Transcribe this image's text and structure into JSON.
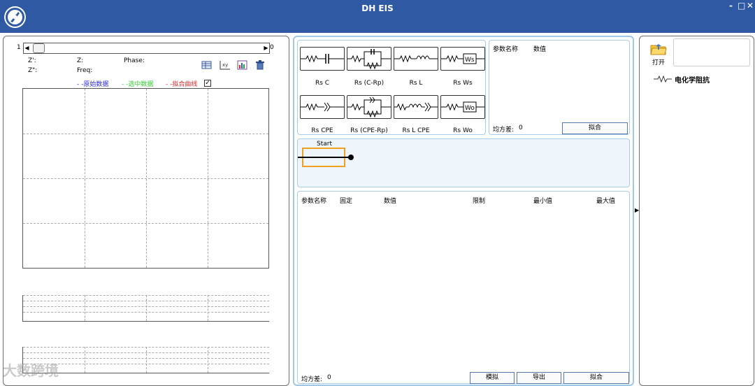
{
  "window": {
    "title": "DH EIS",
    "minimize": "-",
    "maximize": "□",
    "close": "✕"
  },
  "left_panel": {
    "slider": {
      "min_label": "1",
      "max_label": "0"
    },
    "readouts": {
      "z_real": "Z':",
      "z_mag": "Z:",
      "phase": "Phase:",
      "z_imag": "Z\":",
      "freq": "Freq:"
    },
    "legend": {
      "raw": "- -原始数据",
      "selected": "- -选中数据",
      "fit": "- -拟合曲线",
      "raw_color": "#2a2ae0",
      "selected_color": "#2fd22f",
      "fit_color": "#e02a2a"
    },
    "toolbar_icons": [
      "table-icon",
      "xy-plot-icon",
      "chart-export-icon",
      "trash-icon"
    ]
  },
  "circuits": [
    {
      "label": "Rs C",
      "icon": "rs-c-circuit-icon"
    },
    {
      "label": "Rs (C-Rp)",
      "icon": "rs-c-rp-circuit-icon"
    },
    {
      "label": "Rs L",
      "icon": "rs-l-circuit-icon"
    },
    {
      "label": "Rs Ws",
      "icon": "rs-ws-circuit-icon"
    },
    {
      "label": "Rs CPE",
      "icon": "rs-cpe-circuit-icon"
    },
    {
      "label": "Rs (CPE-Rp)",
      "icon": "rs-cpe-rp-circuit-icon"
    },
    {
      "label": "Rs L CPE",
      "icon": "rs-l-cpe-circuit-icon"
    },
    {
      "label": "Rs Wo",
      "icon": "rs-wo-circuit-icon"
    }
  ],
  "param_summary": {
    "col_name": "参数名称",
    "col_value": "数值",
    "mse_label": "均方差:",
    "mse_value": "0",
    "fit_button": "拟合"
  },
  "canvas": {
    "start_label": "Start"
  },
  "param_table": {
    "headers": [
      "参数名称",
      "固定",
      "数值",
      "限制",
      "最小值",
      "最大值"
    ],
    "mse_label": "均方差:",
    "mse_value": "0",
    "simulate_button": "模拟",
    "export_button": "导出",
    "fit_button": "拟合"
  },
  "right_panel": {
    "open_label": "打开",
    "tree_item": "电化学阻抗"
  },
  "watermark": "大数跨境",
  "colors": {
    "titlebar": "#2f5aa3",
    "accent_border": "#9fc9e6",
    "canvas_bg": "#eef6fb",
    "start_box": "#f0a020"
  }
}
